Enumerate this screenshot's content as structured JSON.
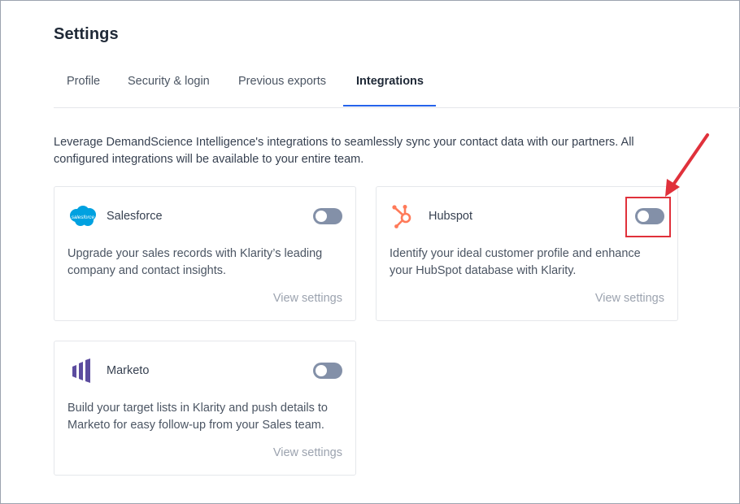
{
  "page": {
    "title": "Settings"
  },
  "tabs": [
    {
      "label": "Profile",
      "active": false
    },
    {
      "label": "Security & login",
      "active": false
    },
    {
      "label": "Previous exports",
      "active": false
    },
    {
      "label": "Integrations",
      "active": true
    }
  ],
  "intro": "Leverage DemandScience Intelligence's integrations to seamlessly sync your contact data with our partners. All configured integrations will be available to your entire team.",
  "integrations": [
    {
      "name": "Salesforce",
      "logo": "salesforce-cloud-icon",
      "logo_text": "salesforce",
      "enabled": false,
      "description": "Upgrade your sales records with Klarity’s leading company and contact insights.",
      "link": "View settings"
    },
    {
      "name": "Hubspot",
      "logo": "hubspot-sprocket-icon",
      "enabled": false,
      "description": "Identify your ideal customer profile and enhance your HubSpot database with Klarity.",
      "link": "View settings"
    },
    {
      "name": "Marketo",
      "logo": "marketo-bars-icon",
      "enabled": false,
      "description": "Build your target lists in Klarity and push details to Marketo for easy follow-up from your Sales team.",
      "link": "View settings"
    }
  ],
  "colors": {
    "accent": "#2563eb",
    "toggle_off": "#8390a8",
    "annotation": "#e0313b",
    "salesforce": "#00a1e0",
    "hubspot": "#ff7a59",
    "marketo": "#5c4c9f"
  }
}
